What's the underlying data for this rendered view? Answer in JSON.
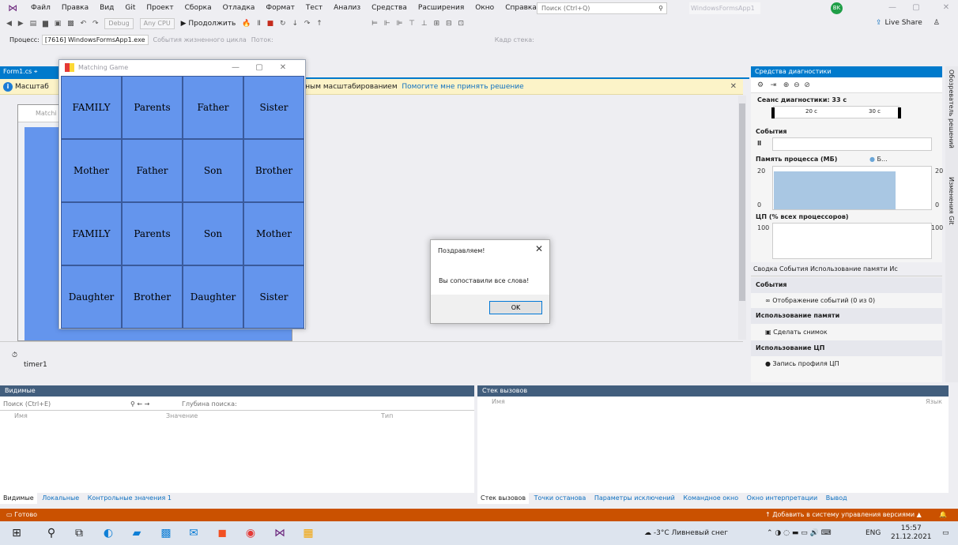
{
  "menu": {
    "items": [
      "Файл",
      "Правка",
      "Вид",
      "Git",
      "Проект",
      "Сборка",
      "Отладка",
      "Формат",
      "Тест",
      "Анализ",
      "Средства",
      "Расширения",
      "Окно",
      "Справка"
    ],
    "search_placeholder": "Поиск (Ctrl+Q)",
    "window_title": "WindowsFormsApp1",
    "avatar": "BK"
  },
  "toolbar": {
    "config": "Debug",
    "platform": "Any CPU",
    "continue": "Продолжить",
    "liveshare": "Live Share"
  },
  "procbar": {
    "process_label": "Процесс:",
    "process": "[7616] WindowsFormsApp1.exe",
    "lifecycle": "События жизненного цикла",
    "thread": "Поток:",
    "stack": "Кадр стека:"
  },
  "doc": {
    "tab": "Form1.cs",
    "info_start": "Масштаб",
    "info_rest": "-ным масштабированием",
    "info_link": "Помогите мне принять решение",
    "behind_title": "Matchi",
    "timer": "timer1"
  },
  "game": {
    "title": "Matching Game",
    "cells": [
      "FAMILY",
      "Parents",
      "Father",
      "Sister",
      "Mother",
      "Father",
      "Son",
      "Brother",
      "FAMILY",
      "Parents",
      "Son",
      "Mother",
      "Daughter",
      "Brother",
      "Daughter",
      "Sister"
    ]
  },
  "dialog": {
    "title": "Поздравляем!",
    "message": "Вы сопоставили все слова!",
    "ok": "OK"
  },
  "diag": {
    "tab": "Средства диагностики",
    "session": "Сеанс диагностики: 33 с",
    "t20": "20 с",
    "t30": "30 с",
    "events": "События",
    "memory": "Память процесса (МБ)",
    "mem_legend": "Б...",
    "mem_top": "20",
    "mem_bottom": "0",
    "cpu": "ЦП (% всех процессоров)",
    "cpu_top": "100",
    "tabs": "Сводка  События  Использование памяти  Ис",
    "sec_events": "События",
    "show_events": "Отображение событий (0 из 0)",
    "sec_mem": "Использование памяти",
    "snapshot": "Сделать снимок",
    "sec_cpu": "Использование ЦП",
    "cpu_profile": "Запись профиля ЦП"
  },
  "rail": {
    "r1": "Обозреватель решений",
    "r2": "Изменения Git"
  },
  "locals": {
    "title": "Видимые",
    "search": "Поиск (Ctrl+E)",
    "depth": "Глубина поиска:",
    "cols": [
      "Имя",
      "Значение",
      "Тип"
    ],
    "tabs": [
      "Видимые",
      "Локальные",
      "Контрольные значения 1"
    ]
  },
  "calls": {
    "title": "Стек вызовов",
    "cols": [
      "Имя",
      "Язык"
    ],
    "tabs": [
      "Стек вызовов",
      "Точки останова",
      "Параметры исключений",
      "Командное окно",
      "Окно интерпретации",
      "Вывод"
    ]
  },
  "status": {
    "ready": "Готово",
    "vcs": "Добавить в систему управления версиями"
  },
  "taskbar": {
    "weather": "-3°C Ливневый снег",
    "lang": "ENG",
    "time": "15:57",
    "date": "21.12.2021"
  }
}
